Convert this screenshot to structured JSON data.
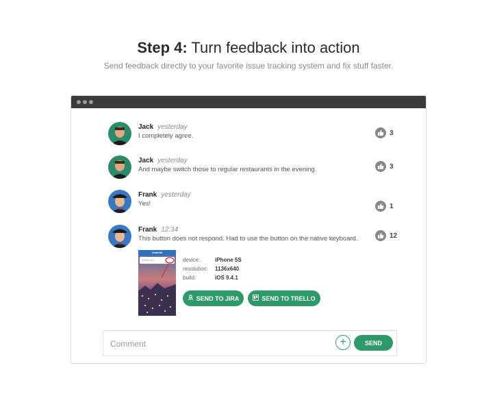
{
  "hero": {
    "title_bold": "Step 4:",
    "title_rest": "Turn feedback into action",
    "subtitle": "Send feedback directly to your favorite issue tracking system and fix stuff faster."
  },
  "comments": [
    {
      "name": "Jack",
      "time": "yesterday",
      "text": "I completely agree.",
      "likes": "3",
      "avatar": "jack-avatar"
    },
    {
      "name": "Jack",
      "time": "yesterday",
      "text": "And maybe switch those to regular restaurants in the evening.",
      "likes": "3",
      "avatar": "jack-avatar"
    },
    {
      "name": "Frank",
      "time": "yesterday",
      "text": "Yes!",
      "likes": "1",
      "avatar": "frank-avatar"
    },
    {
      "name": "Frank",
      "time": "12:34",
      "text": "This button does not respond. Had to use the button on the native keyboard.",
      "likes": "12",
      "avatar": "frank-avatar"
    }
  ],
  "attachment": {
    "device_label": "device:",
    "device_value": "iPhone 5S",
    "resolution_label": "resolution:",
    "resolution_value": "1136x640",
    "build_label": "build:",
    "build_value": "iOS 9.4.1",
    "phone_app_name": "Usabilla",
    "phone_search_placeholder": "Where to?",
    "jira_label": "SEND TO JIRA",
    "trello_label": "SEND TO TRELLO"
  },
  "composer": {
    "placeholder": "Comment",
    "add_label": "+",
    "send_label": "SEND"
  },
  "colors": {
    "accent": "#2e9a6a",
    "titlebar": "#3a3a3a",
    "like_icon": "#888888"
  }
}
